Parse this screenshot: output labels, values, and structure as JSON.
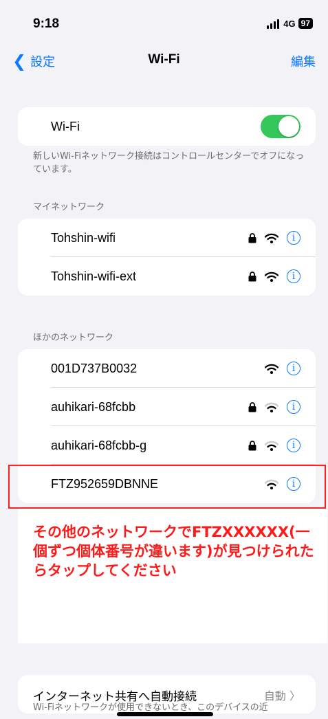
{
  "status": {
    "time": "9:18",
    "network": "4G",
    "battery": "97"
  },
  "nav": {
    "back_label": "設定",
    "title": "Wi-Fi",
    "edit_label": "編集"
  },
  "wifi_toggle": {
    "label": "Wi-Fi",
    "on": true,
    "accent": "#34c759"
  },
  "wifi_note": "新しいWi-Fiネットワーク接続はコントロールセンターでオフになっています。",
  "my_networks": {
    "header": "マイネットワーク",
    "items": [
      {
        "name": "Tohshin-wifi",
        "locked": true,
        "icon": "wifi-icon"
      },
      {
        "name": "Tohshin-wifi-ext",
        "locked": true,
        "icon": "wifi-icon"
      }
    ]
  },
  "other_networks": {
    "header": "ほかのネットワーク",
    "items": [
      {
        "name": "001D737B0032",
        "locked": false,
        "icon": "wifi-icon"
      },
      {
        "name": "auhikari-68fcbb",
        "locked": true,
        "icon": "wifi-icon"
      },
      {
        "name": "auhikari-68fcbb-g",
        "locked": true,
        "icon": "wifi-icon"
      },
      {
        "name": "FTZ952659DBNNE",
        "locked": false,
        "icon": "wifi-icon"
      }
    ]
  },
  "annotation": {
    "text": "その他のネットワークでFTZXXXXXX(一個ずつ個体番号が違います)が見つけられたらタップしてください",
    "color": "#ff1a1a"
  },
  "auto_join": {
    "label": "インターネット共有へ自動接続",
    "value": "自動"
  },
  "bottom_note": "Wi-Fiネットワークが使用できないとき、このデバイスの近",
  "accent_color": "#0a7aff"
}
